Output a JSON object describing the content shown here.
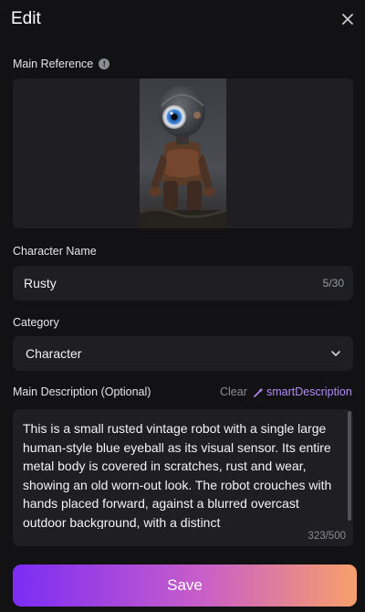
{
  "header": {
    "title": "Edit",
    "close_icon": "close-icon"
  },
  "main_reference": {
    "label": "Main Reference",
    "info_icon": "info-icon",
    "image_alt": "rusted robot with single blue eye"
  },
  "character_name": {
    "label": "Character Name",
    "value": "Rusty",
    "counter": "5/30"
  },
  "category": {
    "label": "Category",
    "value": "Character"
  },
  "main_description": {
    "label": "Main Description (Optional)",
    "clear_label": "Clear",
    "smart_label": "smartDescription",
    "text": "This is a small rusted vintage robot with a single large human-style blue eyeball as its visual sensor. Its entire metal body is covered in scratches, rust and wear, showing an old worn-out look. The robot crouches with hands placed forward, against a blurred overcast outdoor background, with a distinct",
    "counter": "323/500"
  },
  "save_label": "Save",
  "colors": {
    "accent": "#b08cf5",
    "gradient_start": "#7b2cf5",
    "gradient_end": "#f7a06a"
  }
}
